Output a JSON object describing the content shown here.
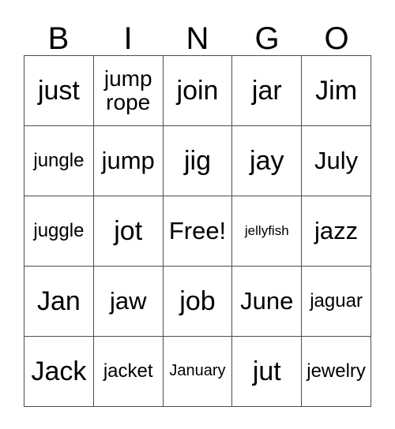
{
  "card": {
    "header": {
      "letters": [
        "B",
        "I",
        "N",
        "G",
        "O"
      ]
    },
    "grid": {
      "rows": [
        [
          {
            "text": "just",
            "size": "xl"
          },
          {
            "text": "jump rope",
            "size": "md"
          },
          {
            "text": "join",
            "size": "xl"
          },
          {
            "text": "jar",
            "size": "xl"
          },
          {
            "text": "Jim",
            "size": "xl"
          }
        ],
        [
          {
            "text": "jungle",
            "size": "sm"
          },
          {
            "text": "jump",
            "size": "lg"
          },
          {
            "text": "jig",
            "size": "xl"
          },
          {
            "text": "jay",
            "size": "xl"
          },
          {
            "text": "July",
            "size": "lg"
          }
        ],
        [
          {
            "text": "juggle",
            "size": "sm"
          },
          {
            "text": "jot",
            "size": "xl"
          },
          {
            "text": "Free!",
            "size": "lg"
          },
          {
            "text": "jellyfish",
            "size": "xxs"
          },
          {
            "text": "jazz",
            "size": "lg"
          }
        ],
        [
          {
            "text": "Jan",
            "size": "xl"
          },
          {
            "text": "jaw",
            "size": "lg"
          },
          {
            "text": "job",
            "size": "xl"
          },
          {
            "text": "June",
            "size": "lg"
          },
          {
            "text": "jaguar",
            "size": "sm"
          }
        ],
        [
          {
            "text": "Jack",
            "size": "xl"
          },
          {
            "text": "jacket",
            "size": "sm"
          },
          {
            "text": "January",
            "size": "xs"
          },
          {
            "text": "jut",
            "size": "xl"
          },
          {
            "text": "jewelry",
            "size": "sm"
          }
        ]
      ]
    },
    "colors": {
      "border": "#4d4d4d",
      "text": "#000000",
      "background": "#ffffff"
    }
  }
}
